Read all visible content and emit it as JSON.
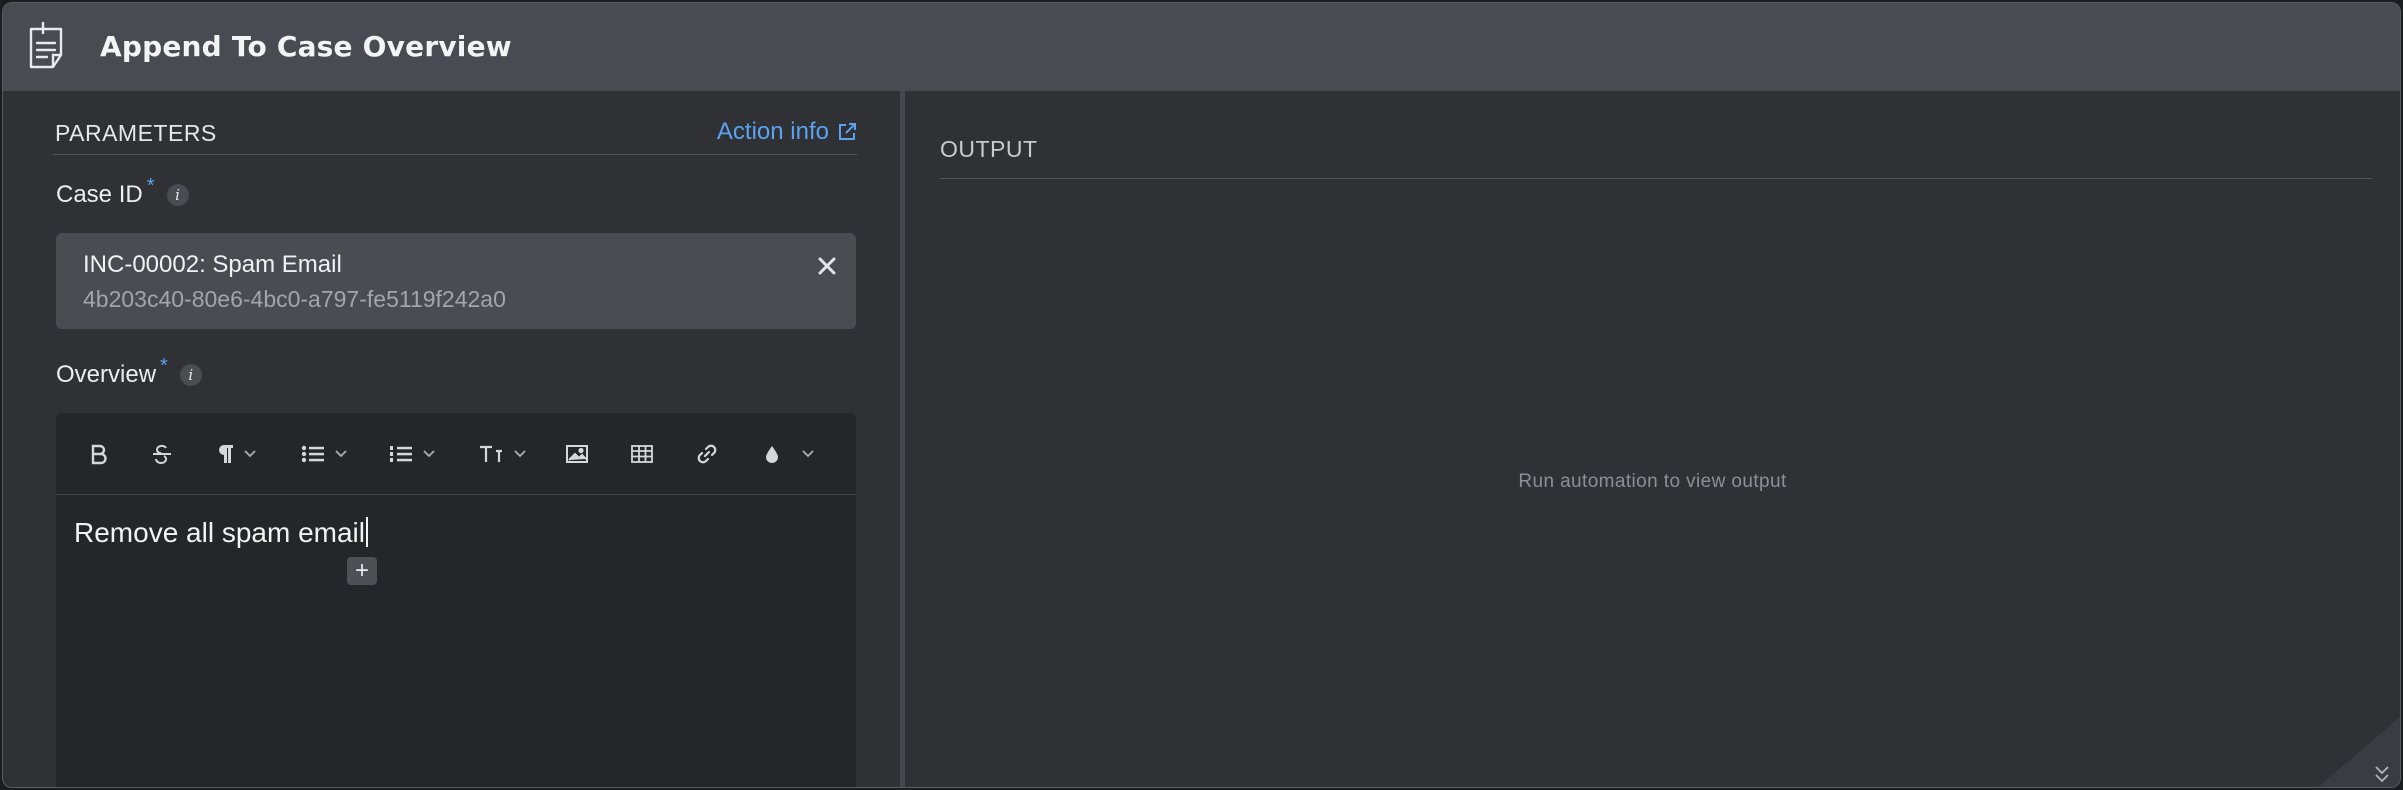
{
  "window": {
    "title": "Append To Case Overview",
    "title_icon": "notes-icon"
  },
  "parameters": {
    "heading": "PARAMETERS",
    "action_info_label": "Action info",
    "case_id": {
      "label": "Case ID",
      "required_mark": "*",
      "info_glyph": "i",
      "selected_title": "INC-00002: Spam Email",
      "selected_id": "4b203c40-80e6-4bc0-a797-fe5119f242a0"
    },
    "overview": {
      "label": "Overview",
      "required_mark": "*",
      "info_glyph": "i",
      "toolbar": [
        "bold",
        "strikethrough",
        "paragraph-format",
        "bullet-list",
        "numbered-list",
        "font-size",
        "image",
        "table",
        "link",
        "text-color"
      ],
      "content": "Remove all spam email",
      "add_glyph": "+"
    }
  },
  "output": {
    "heading": "OUTPUT",
    "empty_message": "Run automation to view output"
  },
  "colors": {
    "accent": "#5aa3f0",
    "titlebar": "#4a4b52",
    "panel": "#303135"
  }
}
